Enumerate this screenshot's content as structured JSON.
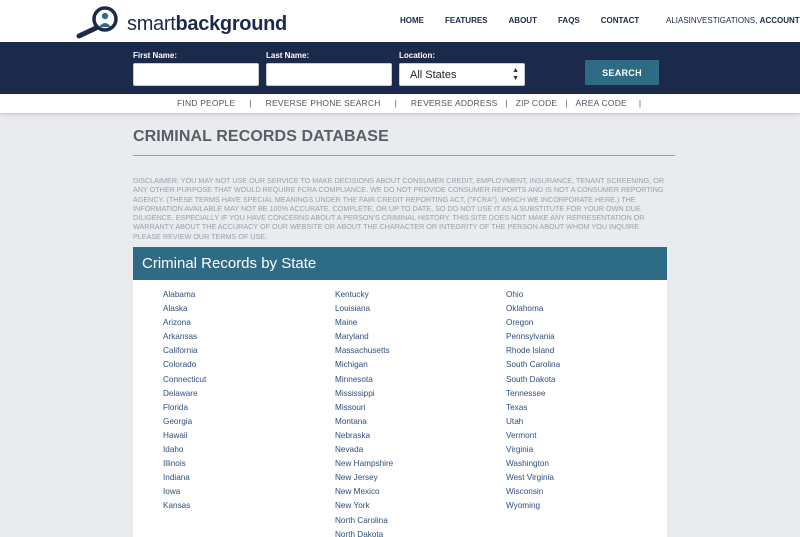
{
  "brand": {
    "light": "smart",
    "bold": "background"
  },
  "nav": {
    "home": "HOME",
    "features": "FEATURES",
    "about": "ABOUT",
    "faqs": "FAQS",
    "contact": "CONTACT"
  },
  "account": {
    "user": "ALIASINVESTIGATIONS,",
    "link": "ACCOUNT"
  },
  "search": {
    "first_name_label": "First Name:",
    "last_name_label": "Last Name:",
    "location_label": "Location:",
    "first_name_value": "",
    "last_name_value": "",
    "location_value": "All States",
    "button": "SEARCH"
  },
  "subnav": {
    "find_people": "FIND PEOPLE",
    "reverse_phone": "REVERSE PHONE SEARCH",
    "reverse_address": "REVERSE ADDRESS",
    "zip_code": "ZIP CODE",
    "area_code": "AREA CODE",
    "separator": "|"
  },
  "page": {
    "title": "CRIMINAL RECORDS DATABASE",
    "disclaimer": "DISCLAIMER: YOU MAY NOT USE OUR SERVICE TO MAKE DECISIONS ABOUT CONSUMER CREDIT, EMPLOYMENT, INSURANCE, TENANT SCREENING, OR ANY OTHER PURPOSE THAT WOULD REQUIRE FCRA COMPLIANCE. WE DO NOT PROVIDE CONSUMER REPORTS AND IS NOT A CONSUMER REPORTING AGENCY. (THESE TERMS HAVE SPECIAL MEANINGS UNDER THE FAIR CREDIT REPORTING ACT, (\"FCRA\"), WHICH WE INCORPORATE HERE.) THE INFORMATION AVAILABLE MAY NOT BE 100% ACCURATE, COMPLETE, OR UP TO DATE, SO DO NOT USE IT AS A SUBSTITUTE FOR YOUR OWN DUE DILIGENCE, ESPECIALLY IF YOU HAVE CONCERNS ABOUT A PERSON'S CRIMINAL HISTORY. THIS SITE DOES NOT MAKE ANY REPRESENTATION OR WARRANTY ABOUT THE ACCURACY OF OUR WEBSITE OR ABOUT THE CHARACTER OR INTEGRITY OF THE PERSON ABOUT WHOM YOU INQUIRE. PLEASE REVIEW OUR TERMS OF USE."
  },
  "states_panel": {
    "title": "Criminal Records by State",
    "columns": [
      [
        "Alabama",
        "Alaska",
        "Arizona",
        "Arkansas",
        "California",
        "Colorado",
        "Connecticut",
        "Delaware",
        "Florida",
        "Georgia",
        "Hawaii",
        "Idaho",
        "Illinois",
        "Indiana",
        "Iowa",
        "Kansas"
      ],
      [
        "Kentucky",
        "Louisiana",
        "Maine",
        "Maryland",
        "Massachusetts",
        "Michigan",
        "Minnesota",
        "Mississippi",
        "Missouri",
        "Montana",
        "Nebraska",
        "Nevada",
        "New Hampshire",
        "New Jersey",
        "New Mexico",
        "New York",
        "North Carolina",
        "North Dakota"
      ],
      [
        "Ohio",
        "Oklahoma",
        "Oregon",
        "Pennsylvania",
        "Rhode Island",
        "South Carolina",
        "South Dakota",
        "Tennessee",
        "Texas",
        "Utah",
        "Vermont",
        "Virginia",
        "Washington",
        "West Virginia",
        "Wisconsin",
        "Wyoming"
      ]
    ]
  },
  "colors": {
    "navy": "#1b2a4a",
    "teal": "#2e6b84",
    "link": "#2d4f7c",
    "background": "#e9ebef"
  },
  "icons": {
    "logo": "magnifier-person-icon",
    "select_arrows": "updown-arrows-icon"
  }
}
